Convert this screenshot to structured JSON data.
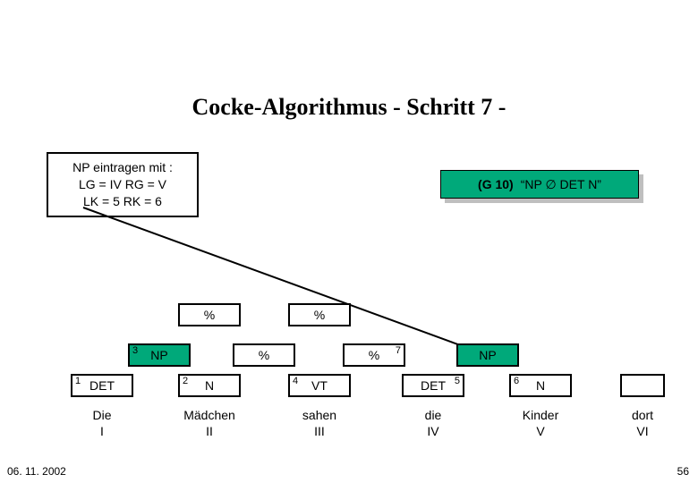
{
  "title": "Cocke-Algorithmus - Schritt 7 -",
  "info": {
    "l1": "NP eintragen mit :",
    "l2": "LG = IV RG = V",
    "l3": "LK = 5  RK = 6"
  },
  "rule": {
    "id": "(G 10)",
    "text": "“NP ∅ DET N”"
  },
  "row4": {
    "c3": "%",
    "c4": "%"
  },
  "row3": {
    "sup": "3",
    "np1": "NP",
    "c3": "%",
    "c5": "%",
    "sup7": "7",
    "np2": "NP"
  },
  "row1": {
    "s1": "1",
    "det1": "DET",
    "s2": "2",
    "n1": "N",
    "s4": "4",
    "vt": "VT",
    "s5": "5",
    "det2": "DET",
    "s6": "6",
    "n2": "N"
  },
  "words": {
    "w1": "Die",
    "w2": "Mädchen",
    "w3": "sahen",
    "w4": "die",
    "w5": "Kinder",
    "w6": "dort"
  },
  "roman": {
    "r1": "I",
    "r2": "II",
    "r3": "III",
    "r4": "IV",
    "r5": "V",
    "r6": "VI"
  },
  "footer": {
    "date": "06. 11. 2002",
    "page": "56"
  }
}
